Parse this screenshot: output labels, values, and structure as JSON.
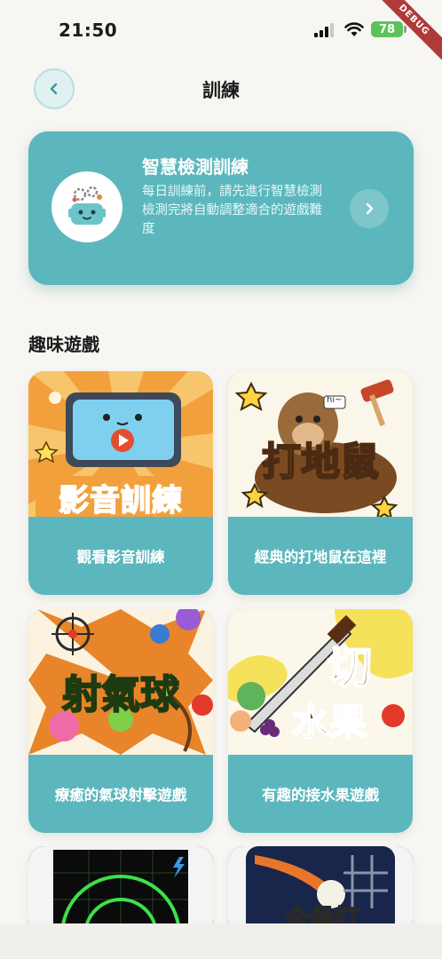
{
  "status_bar": {
    "time": "21:50",
    "battery": "78",
    "debug": "DEBUG"
  },
  "header": {
    "title": "訓練"
  },
  "detect_card": {
    "title": "智慧檢測訓練",
    "line1": "每日訓練前，請先進行智慧檢測",
    "line2": "檢測完將自動調整適合的遊戲難度"
  },
  "section": {
    "title": "趣味遊戲"
  },
  "games": [
    {
      "label": "觀看影音訓練",
      "art_text": "影音訓練"
    },
    {
      "label": "經典的打地鼠在這裡",
      "art_text": "打地鼠",
      "badge": "hi~"
    },
    {
      "label": "療癒的氣球射擊遊戲",
      "art_text": "射氣球"
    },
    {
      "label": "有趣的接水果遊戲",
      "art_text_1": "切",
      "art_text_2": "水果"
    },
    {
      "label": "",
      "art_text": ""
    },
    {
      "label": "",
      "art_text": "全壘打"
    }
  ],
  "colors": {
    "accent": "#5bb7bd",
    "background": "#f7f6f2"
  }
}
